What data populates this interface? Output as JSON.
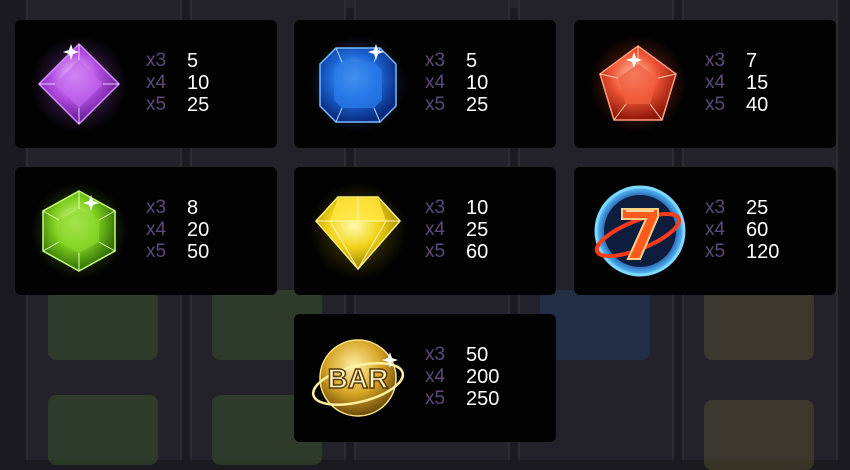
{
  "paytable": [
    {
      "symbol": "purple-gem",
      "rows": [
        {
          "mult": "x3",
          "value": "5"
        },
        {
          "mult": "x4",
          "value": "10"
        },
        {
          "mult": "x5",
          "value": "25"
        }
      ]
    },
    {
      "symbol": "blue-gem",
      "rows": [
        {
          "mult": "x3",
          "value": "5"
        },
        {
          "mult": "x4",
          "value": "10"
        },
        {
          "mult": "x5",
          "value": "25"
        }
      ]
    },
    {
      "symbol": "red-gem",
      "rows": [
        {
          "mult": "x3",
          "value": "7"
        },
        {
          "mult": "x4",
          "value": "15"
        },
        {
          "mult": "x5",
          "value": "40"
        }
      ]
    },
    {
      "symbol": "green-gem",
      "rows": [
        {
          "mult": "x3",
          "value": "8"
        },
        {
          "mult": "x4",
          "value": "20"
        },
        {
          "mult": "x5",
          "value": "50"
        }
      ]
    },
    {
      "symbol": "yellow-gem",
      "rows": [
        {
          "mult": "x3",
          "value": "10"
        },
        {
          "mult": "x4",
          "value": "25"
        },
        {
          "mult": "x5",
          "value": "60"
        }
      ]
    },
    {
      "symbol": "lucky-seven",
      "rows": [
        {
          "mult": "x3",
          "value": "25"
        },
        {
          "mult": "x4",
          "value": "60"
        },
        {
          "mult": "x5",
          "value": "120"
        }
      ]
    },
    {
      "symbol": "bar",
      "rows": [
        {
          "mult": "x3",
          "value": "50"
        },
        {
          "mult": "x4",
          "value": "200"
        },
        {
          "mult": "x5",
          "value": "250"
        }
      ]
    }
  ],
  "bar_logo_text": "BAR",
  "colors": {
    "card_bg": "#020202",
    "multiplier": "#5d4a78",
    "value": "#ffffff"
  }
}
